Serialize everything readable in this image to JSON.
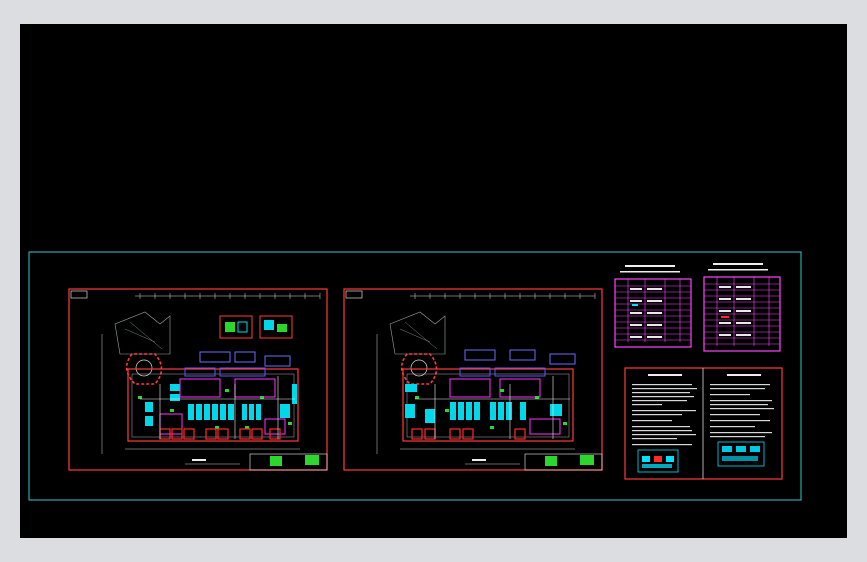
{
  "app": {
    "title": ""
  },
  "colors": {
    "background": "#000000",
    "frame": "#38c8c8",
    "sheet_border": "#ff3a3a",
    "table_border": "#ff44ff",
    "cyan": "#00e0ff",
    "magenta": "#ff33ff",
    "green": "#2cd62c",
    "white": "#f2f2f2",
    "red": "#ff2a2a"
  },
  "icons": [
    "cad-drawing-viewport"
  ],
  "drawings": [
    {
      "id": "plan-left",
      "kind": "floor-plan"
    },
    {
      "id": "plan-right",
      "kind": "floor-plan"
    },
    {
      "id": "schedule-left",
      "kind": "equipment-table"
    },
    {
      "id": "schedule-right",
      "kind": "equipment-table"
    },
    {
      "id": "notes-sheet",
      "kind": "design-notes"
    }
  ]
}
